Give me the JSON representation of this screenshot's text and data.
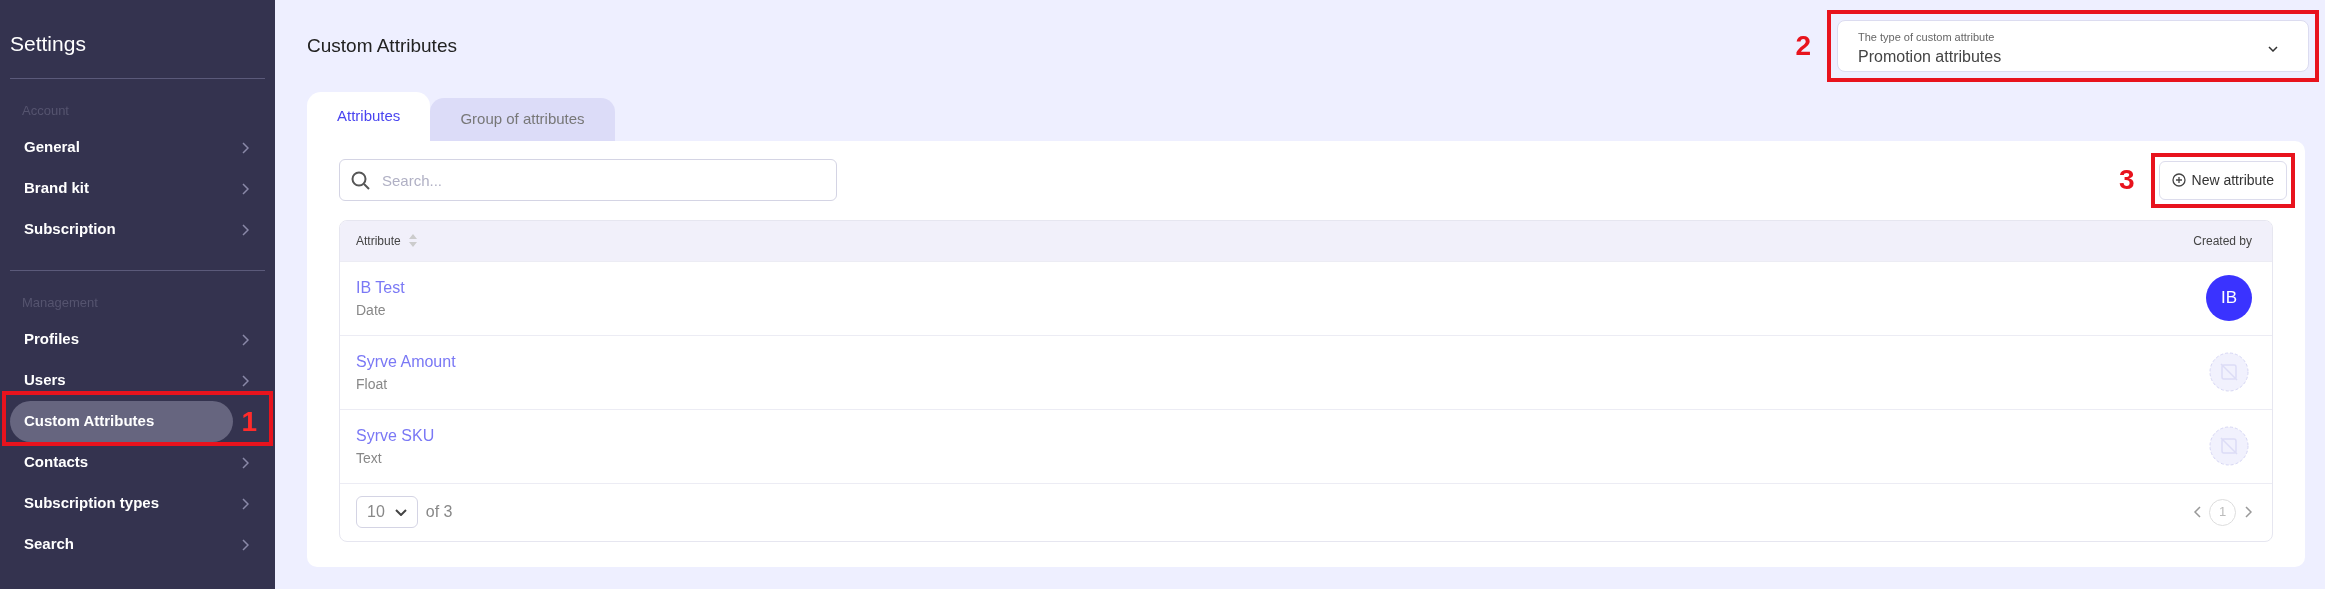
{
  "sidebar": {
    "title": "Settings",
    "sections": [
      {
        "heading": "Account",
        "items": [
          {
            "label": "General",
            "selected": false
          },
          {
            "label": "Brand kit",
            "selected": false
          },
          {
            "label": "Subscription",
            "selected": false
          }
        ]
      },
      {
        "heading": "Management",
        "items": [
          {
            "label": "Profiles",
            "selected": false
          },
          {
            "label": "Users",
            "selected": false
          },
          {
            "label": "Custom Attributes",
            "selected": true,
            "annotation": "1"
          },
          {
            "label": "Contacts",
            "selected": false
          },
          {
            "label": "Subscription types",
            "selected": false
          },
          {
            "label": "Search",
            "selected": false
          }
        ]
      }
    ]
  },
  "page_title": "Custom Attributes",
  "type_select": {
    "label": "The type of custom attribute",
    "value": "Promotion attributes",
    "annotation": "2"
  },
  "tabs": [
    {
      "label": "Attributes",
      "selected": true
    },
    {
      "label": "Group of attributes",
      "selected": false
    }
  ],
  "search": {
    "placeholder": "Search..."
  },
  "new_button": {
    "label": "New attribute",
    "annotation": "3"
  },
  "table": {
    "columns": [
      "Attribute",
      "Created by"
    ],
    "rows": [
      {
        "name": "IB Test",
        "type": "Date",
        "creator": {
          "kind": "initials",
          "text": "IB"
        }
      },
      {
        "name": "Syrve Amount",
        "type": "Float",
        "creator": {
          "kind": "placeholder"
        }
      },
      {
        "name": "Syrve SKU",
        "type": "Text",
        "creator": {
          "kind": "placeholder"
        }
      }
    ]
  },
  "pagination": {
    "page_size": "10",
    "total": "of 3",
    "pages": [
      {
        "label": "1",
        "selected": true
      }
    ]
  }
}
